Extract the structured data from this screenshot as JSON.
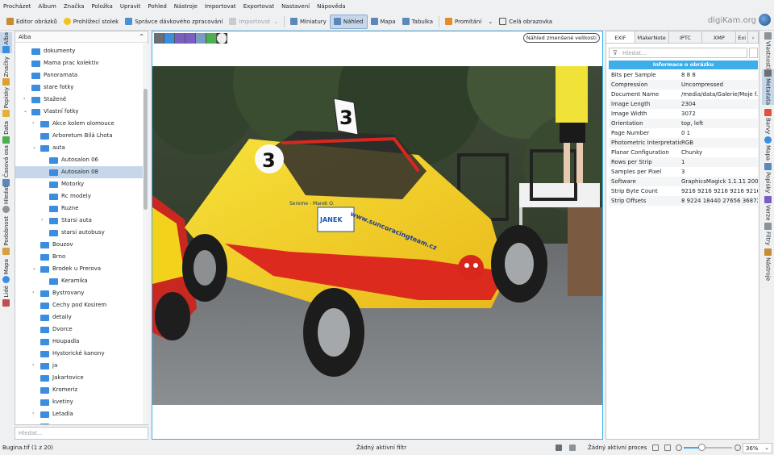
{
  "menu": [
    "Procházet",
    "Album",
    "Značka",
    "Položka",
    "Upravit",
    "Pohled",
    "Nástroje",
    "Importovat",
    "Exportovat",
    "Nastavení",
    "Nápověda"
  ],
  "toolbar": {
    "editor": "Editor obrázků",
    "light_table": "Prohlížecí stolek",
    "batch": "Správce dávkového zpracování",
    "import": "Importovat",
    "thumbnails": "Miniatury",
    "preview": "Náhled",
    "map": "Mapa",
    "table": "Tabulka",
    "slideshow": "Promítání",
    "fullscreen": "Celá obrazovka",
    "brand": "digiKam.org"
  },
  "left_tabs": [
    "Alba",
    "Značky",
    "Popisky",
    "Data",
    "Časová osa",
    "Hledat",
    "Podobnost",
    "Mapa",
    "Lidé"
  ],
  "albums": {
    "title": "Alba",
    "items": [
      {
        "label": "dokumenty",
        "depth": 1,
        "arrow": ""
      },
      {
        "label": "Mama prac kolektiv",
        "depth": 1,
        "arrow": ""
      },
      {
        "label": "Panoramata",
        "depth": 1,
        "arrow": ""
      },
      {
        "label": "stare fotky",
        "depth": 1,
        "arrow": ""
      },
      {
        "label": "Stažené",
        "depth": 1,
        "arrow": "›"
      },
      {
        "label": "Vlastní fotky",
        "depth": 1,
        "arrow": "⌄"
      },
      {
        "label": "Akce kolem olomouce",
        "depth": 2,
        "arrow": "›"
      },
      {
        "label": "Arboretum Bílá Lhota",
        "depth": 2,
        "arrow": ""
      },
      {
        "label": "auta",
        "depth": 2,
        "arrow": "⌄"
      },
      {
        "label": "Autosalon 06",
        "depth": 3,
        "arrow": ""
      },
      {
        "label": "Autosalon 08",
        "depth": 3,
        "arrow": "",
        "selected": true
      },
      {
        "label": "Motorky",
        "depth": 3,
        "arrow": ""
      },
      {
        "label": "Rc modely",
        "depth": 3,
        "arrow": ""
      },
      {
        "label": "Ruzne",
        "depth": 3,
        "arrow": ""
      },
      {
        "label": "Starsi auta",
        "depth": 3,
        "arrow": "›"
      },
      {
        "label": "starsi autobusy",
        "depth": 3,
        "arrow": ""
      },
      {
        "label": "Bouzov",
        "depth": 2,
        "arrow": ""
      },
      {
        "label": "Brno",
        "depth": 2,
        "arrow": ""
      },
      {
        "label": "Brodek u Prerova",
        "depth": 2,
        "arrow": "⌄"
      },
      {
        "label": "Keramika",
        "depth": 3,
        "arrow": ""
      },
      {
        "label": "Bystrovany",
        "depth": 2,
        "arrow": "›"
      },
      {
        "label": "Cechy pod Kosirem",
        "depth": 2,
        "arrow": ""
      },
      {
        "label": "detaily",
        "depth": 2,
        "arrow": ""
      },
      {
        "label": "Dvorce",
        "depth": 2,
        "arrow": ""
      },
      {
        "label": "Houpadla",
        "depth": 2,
        "arrow": ""
      },
      {
        "label": "Hystorické kanony",
        "depth": 2,
        "arrow": ""
      },
      {
        "label": "ja",
        "depth": 2,
        "arrow": "›"
      },
      {
        "label": "Jakartovice",
        "depth": 2,
        "arrow": ""
      },
      {
        "label": "Kromeriz",
        "depth": 2,
        "arrow": ""
      },
      {
        "label": "kvetiny",
        "depth": 2,
        "arrow": ""
      },
      {
        "label": "Letadla",
        "depth": 2,
        "arrow": "›"
      },
      {
        "label": "",
        "depth": 2,
        "arrow": ""
      }
    ],
    "search_placeholder": "Hledat..."
  },
  "viewer": {
    "preview_label": "Náhled zmenšené velikosti",
    "photo": {
      "car_number": "3",
      "sponsor_text": "www.suncoracingteam.cz",
      "janek_text": "JANEK",
      "driver_text": "Sereme - Marek O."
    }
  },
  "right_panel": {
    "tabs": [
      "EXIF",
      "MakerNote",
      "IPTC",
      "XMP",
      "Exi"
    ],
    "active_tab": "EXIF",
    "search_placeholder": "Hledat...",
    "section_title": "Informace o obrázku",
    "rows": [
      {
        "key": "Bits per Sample",
        "value": "8 8 8"
      },
      {
        "key": "Compression",
        "value": "Uncompressed"
      },
      {
        "key": "Document Name",
        "value": "/media/data/Galerie/Moje f..."
      },
      {
        "key": "Image Length",
        "value": "2304"
      },
      {
        "key": "Image Width",
        "value": "3072"
      },
      {
        "key": "Orientation",
        "value": "top, left"
      },
      {
        "key": "Page Number",
        "value": "0 1"
      },
      {
        "key": "Photometric Interpretation",
        "value": "RGB"
      },
      {
        "key": "Planar Configuration",
        "value": "Chunky"
      },
      {
        "key": "Rows per Strip",
        "value": "1"
      },
      {
        "key": "Samples per Pixel",
        "value": "3"
      },
      {
        "key": "Software",
        "value": "GraphicsMagick 1.1.11 200..."
      },
      {
        "key": "Strip Byte Count",
        "value": "9216 9216 9216 9216 9216 ..."
      },
      {
        "key": "Strip Offsets",
        "value": "8 9224 18440 27656 36872 ..."
      }
    ]
  },
  "right_tabs": [
    "Vlastnosti",
    "Metadata",
    "Barvy",
    "Mapa",
    "Popisky",
    "Verze",
    "Filtry",
    "Nástroje"
  ],
  "status": {
    "file": "Bugina.tif (1 z 20)",
    "filter": "Žádný aktivní filtr",
    "process": "Žádný aktivní proces",
    "zoom": "36%",
    "zoom_fraction": 0.36
  },
  "colors": {
    "accent": "#3daee9",
    "selection": "#c7d7ea",
    "folder": "#3b8de0",
    "car_yellow": "#f2d21b",
    "car_red": "#d8281e"
  }
}
